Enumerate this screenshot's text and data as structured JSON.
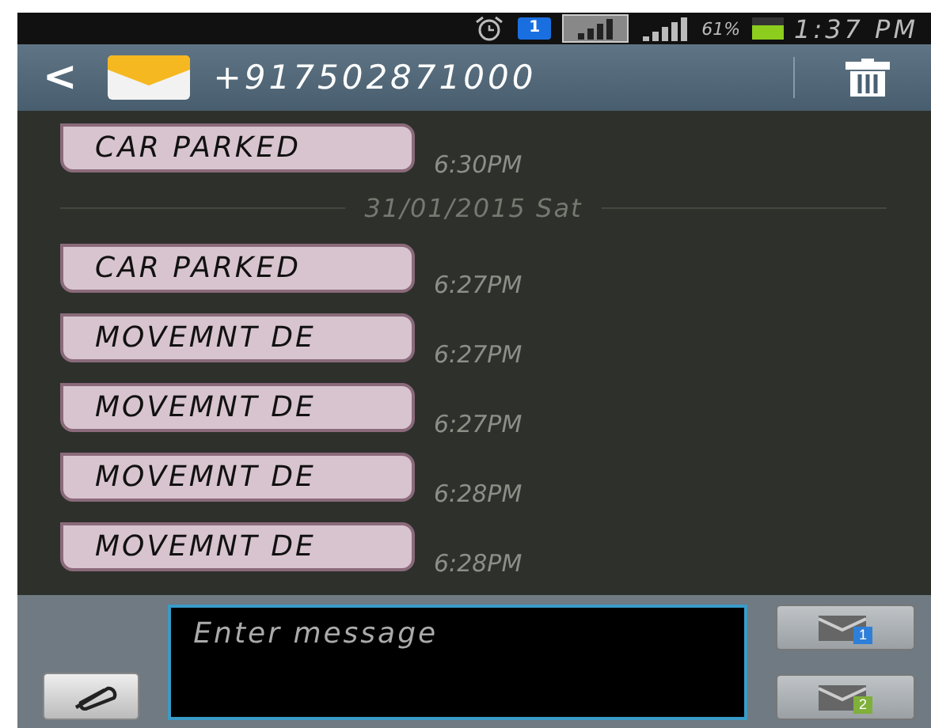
{
  "status_bar": {
    "sim_badge": "1",
    "battery_percent": "61%",
    "time": "1:37 PM"
  },
  "header": {
    "back": "<",
    "contact": "+917502871000"
  },
  "thread": [
    {
      "kind": "message",
      "text": "CAR PARKED",
      "time": "6:30PM"
    },
    {
      "kind": "date",
      "text": "31/01/2015 Sat"
    },
    {
      "kind": "message",
      "text": "CAR PARKED",
      "time": "6:27PM"
    },
    {
      "kind": "message",
      "text": "MOVEMNT DE",
      "time": "6:27PM"
    },
    {
      "kind": "message",
      "text": "MOVEMNT DE",
      "time": "6:27PM"
    },
    {
      "kind": "message",
      "text": "MOVEMNT DE",
      "time": "6:28PM"
    },
    {
      "kind": "message",
      "text": "MOVEMNT DE",
      "time": "6:28PM"
    }
  ],
  "composer": {
    "placeholder": "Enter message",
    "send_buttons": [
      {
        "sim": "1",
        "color": "#2f7fd8"
      },
      {
        "sim": "2",
        "color": "#7fb03a"
      }
    ]
  }
}
